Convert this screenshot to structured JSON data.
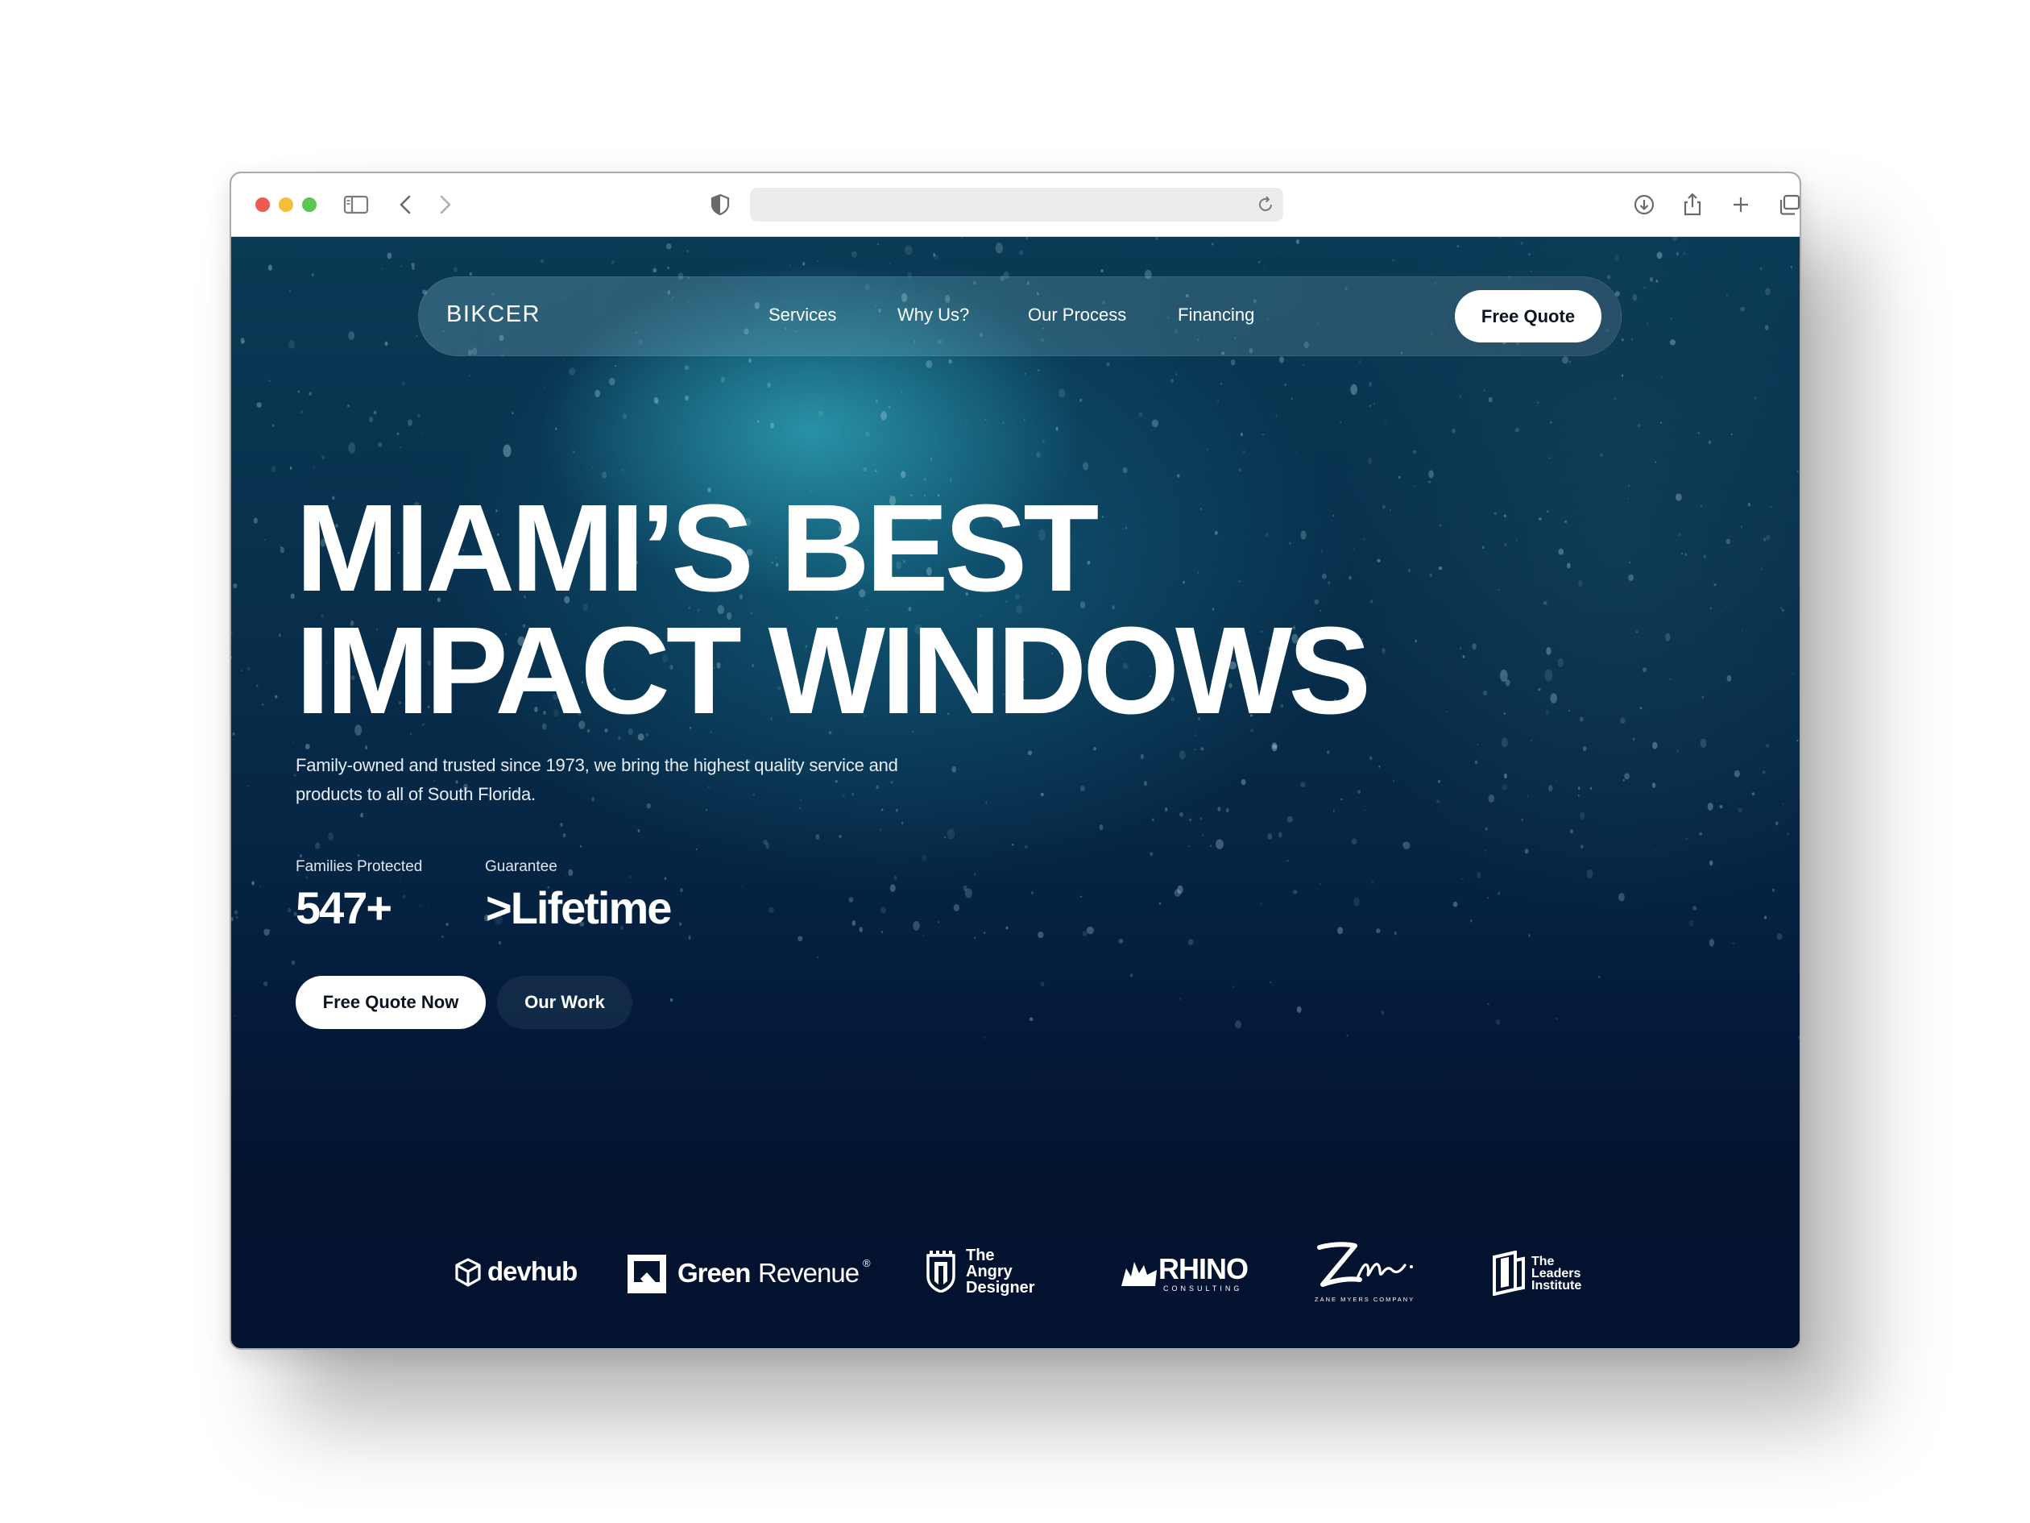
{
  "nav": {
    "logo": "BIKCER",
    "links": [
      "Services",
      "Why Us?",
      "Our Process",
      "Financing"
    ],
    "cta": "Free Quote"
  },
  "hero": {
    "headline_line1": "MIAMI’S BEST",
    "headline_line2": "IMPACT WINDOWS",
    "subtitle_line1": "Family-owned and trusted since 1973, we bring the highest quality service and",
    "subtitle_line2": "products to all of South Florida.",
    "stats": [
      {
        "label": "Families Protected",
        "value": "547+"
      },
      {
        "label": "Guarantee",
        "value": ">Lifetime"
      }
    ],
    "primary_button": "Free Quote Now",
    "secondary_button": "Our Work"
  },
  "clients": {
    "devhub": "devhub",
    "greenrevenue_a": "Green",
    "greenrevenue_b": "Revenue",
    "greenrevenue_mark": "®",
    "angry_1": "The",
    "angry_2": "Angry",
    "angry_3": "Designer",
    "rhino": "RHINO",
    "rhino_sub": "CONSULTING",
    "zane_sub": "ZANE MYERS COMPANY",
    "leaders_1": "The",
    "leaders_2": "Leaders",
    "leaders_3": "Institute"
  },
  "icons": {
    "traffic_lights": [
      "close-dot",
      "minimize-dot",
      "zoom-dot"
    ],
    "toolbar_left": [
      "sidebar-icon",
      "back-icon",
      "forward-icon"
    ],
    "privacy": "shield-icon",
    "address_bar": "reload-icon",
    "toolbar_right": [
      "download-icon",
      "share-icon",
      "new-tab-icon",
      "tabs-overview-icon"
    ]
  },
  "colors": {
    "page_background_top": "#0a3a55",
    "page_background_bottom": "#031230",
    "button_background": "#ffffff",
    "button_text": "#0b1420"
  }
}
